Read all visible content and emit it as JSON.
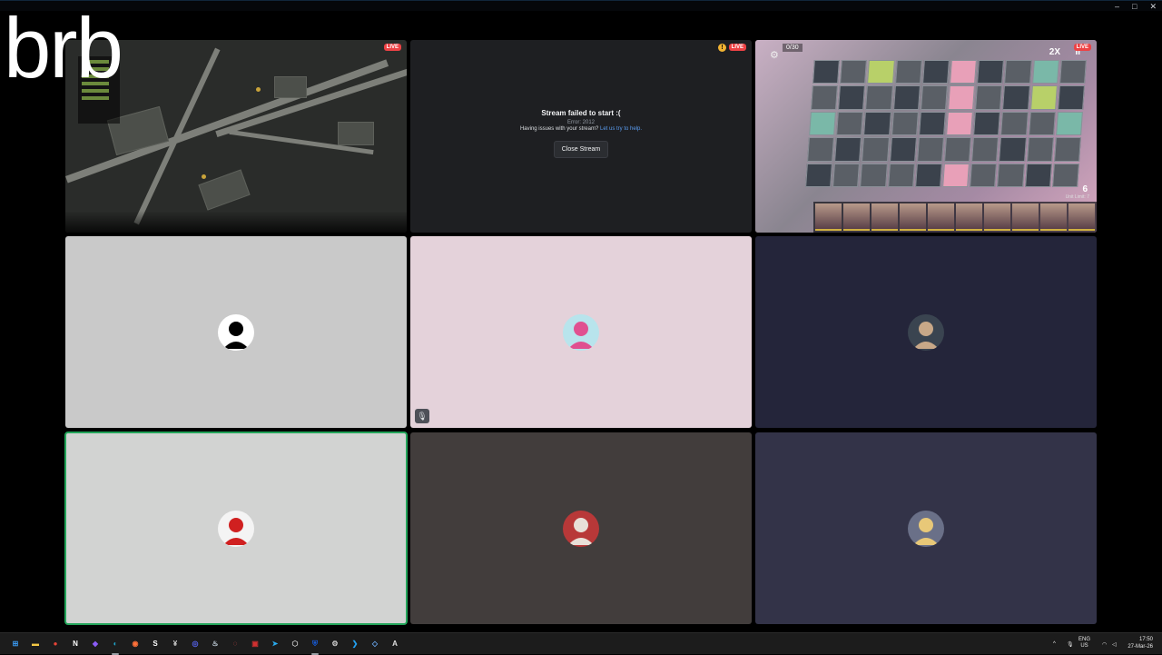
{
  "window": {
    "minimize": "–",
    "maximize": "□",
    "close": "✕"
  },
  "overlay": {
    "brb_text": "brb"
  },
  "streams": {
    "map": {
      "live_badge": "LIVE"
    },
    "failed": {
      "warn_badge": "!",
      "live_badge": "LIVE",
      "title": "Stream failed to start :(",
      "error": "Error: 2012",
      "help_prefix": "Having issues with your stream?",
      "help_link": "Let us try to help.",
      "close_button": "Close Stream"
    },
    "game": {
      "live_badge": "LIVE",
      "kill_count": "0/30",
      "speed": "2X",
      "pause": "II",
      "gear": "⚙",
      "deploy_count": "6",
      "unit_limit": "Unit Limit: 7"
    }
  },
  "participants": [
    {
      "id": "p1",
      "bg": "#c9c9c9",
      "avatar_bg": "#ffffff",
      "avatar_fg": "#000000",
      "muted": false,
      "speaking": false
    },
    {
      "id": "p2",
      "bg": "#e4d2da",
      "avatar_bg": "#b8e4ec",
      "avatar_fg": "#e05090",
      "muted": true,
      "speaking": false,
      "mute_icon": "🎙"
    },
    {
      "id": "p3",
      "bg": "#24253a",
      "avatar_bg": "#3a4450",
      "avatar_fg": "#c8a888",
      "muted": false,
      "speaking": false
    },
    {
      "id": "p4",
      "bg": "#d2d3d2",
      "avatar_bg": "#f4f4f4",
      "avatar_fg": "#d02020",
      "muted": false,
      "speaking": true
    },
    {
      "id": "p5",
      "bg": "#423d3c",
      "avatar_bg": "#b83838",
      "avatar_fg": "#e8e0d8",
      "muted": false,
      "speaking": false
    },
    {
      "id": "p6",
      "bg": "#333348",
      "avatar_bg": "#6a7088",
      "avatar_fg": "#e8c878",
      "muted": false,
      "speaking": false
    }
  ],
  "taskbar": {
    "apps": [
      {
        "name": "start",
        "glyph": "⊞",
        "color": "#3b9cf5"
      },
      {
        "name": "file-explorer",
        "glyph": "▬",
        "color": "#f2c744"
      },
      {
        "name": "chrome",
        "glyph": "●",
        "color": "#e84437"
      },
      {
        "name": "notion",
        "glyph": "N",
        "color": "#ffffff"
      },
      {
        "name": "obsidian",
        "glyph": "◆",
        "color": "#8b5cf6"
      },
      {
        "name": "edge",
        "glyph": "◐",
        "color": "#1fa3c8"
      },
      {
        "name": "firefox",
        "glyph": "◉",
        "color": "#ff7139"
      },
      {
        "name": "app-s",
        "glyph": "S",
        "color": "#ffffff"
      },
      {
        "name": "app-v",
        "glyph": "¥",
        "color": "#d8d8d8"
      },
      {
        "name": "discord",
        "glyph": "◎",
        "color": "#5865f2"
      },
      {
        "name": "steam",
        "glyph": "♨",
        "color": "#c6d4df"
      },
      {
        "name": "app-circle",
        "glyph": "◌",
        "color": "#e85050"
      },
      {
        "name": "app-red",
        "glyph": "▣",
        "color": "#d03030"
      },
      {
        "name": "telegram",
        "glyph": "➤",
        "color": "#2aabee"
      },
      {
        "name": "app-hex",
        "glyph": "⬡",
        "color": "#cfcfcf"
      },
      {
        "name": "bitwarden",
        "glyph": "⛨",
        "color": "#175ddc"
      },
      {
        "name": "settings",
        "glyph": "⚙",
        "color": "#cfcfcf"
      },
      {
        "name": "vscode",
        "glyph": "❯",
        "color": "#23a0f0"
      },
      {
        "name": "app-diamond",
        "glyph": "◇",
        "color": "#6aa8f0"
      },
      {
        "name": "app-a",
        "glyph": "A",
        "color": "#e0e0e0"
      }
    ],
    "tray_chevron": "^",
    "tray_mic": "🎙",
    "lang_line1": "ENG",
    "lang_line2": "US",
    "time": "17:50",
    "date": "27-Mar-26"
  }
}
